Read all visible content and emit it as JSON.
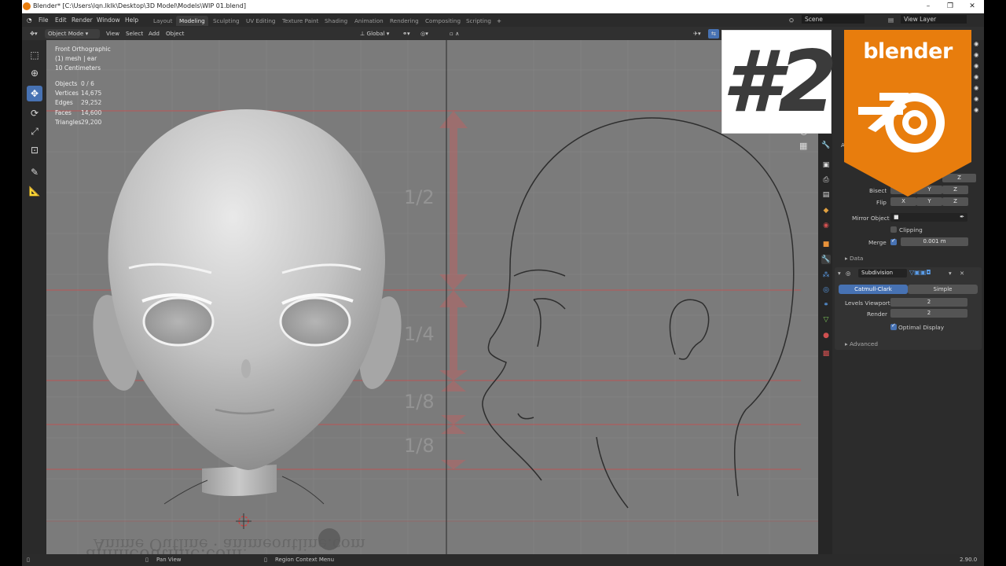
{
  "window": {
    "title": "Blender* [C:\\Users\\lqn.lklk\\Desktop\\3D Model\\Models\\WIP 01.blend]",
    "minimize": "–",
    "maximize": "❐",
    "close": "✕"
  },
  "menu": [
    "File",
    "Edit",
    "Render",
    "Window",
    "Help"
  ],
  "workspaces": [
    "Layout",
    "Modeling",
    "Sculpting",
    "UV Editing",
    "Texture Paint",
    "Shading",
    "Animation",
    "Rendering",
    "Compositing",
    "Scripting"
  ],
  "active_workspace": "Modeling",
  "add_workspace": "+",
  "scene": {
    "label": "Scene",
    "layer": "View Layer"
  },
  "header": {
    "mode": "Object Mode",
    "items": [
      "View",
      "Select",
      "Add",
      "Object"
    ],
    "orientation": "Global"
  },
  "viewport": {
    "view_name": "Front Orthographic",
    "object_info": "(1) mesh | ear",
    "scale": "10 Centimeters",
    "stats": [
      {
        "label": "Objects",
        "value": "0 / 6"
      },
      {
        "label": "Vertices",
        "value": "14,675"
      },
      {
        "label": "Edges",
        "value": "29,252"
      },
      {
        "label": "Faces",
        "value": "14,600"
      },
      {
        "label": "Triangles",
        "value": "29,200"
      }
    ],
    "proportion_labels": [
      "1/2",
      "1/4",
      "1/8",
      "1/8"
    ],
    "watermark": "Anime Outline · animeoutline.com"
  },
  "overlay": {
    "episode": "#2",
    "brand": "blender"
  },
  "properties": {
    "mirror": {
      "axis_z": "Z",
      "bisect_label": "Bisect",
      "flip_label": "Flip",
      "axes": [
        "X",
        "Y",
        "Z"
      ],
      "mirror_object_label": "Mirror Object",
      "clipping_label": "Clipping",
      "merge_label": "Merge",
      "merge_value": "0.001 m",
      "data_label": "Data"
    },
    "subdivision": {
      "name": "Subdivision",
      "catmull": "Catmull-Clark",
      "simple": "Simple",
      "levels_viewport_label": "Levels Viewport",
      "levels_viewport": "2",
      "render_label": "Render",
      "render": "2",
      "optimal_display": "Optimal Display",
      "advanced": "Advanced"
    }
  },
  "status": {
    "pan": "Pan View",
    "context": "Region Context Menu",
    "version": "2.90.0"
  },
  "colors": {
    "accent": "#4772b3",
    "blender_orange": "#e87d0d",
    "viewport_bg": "#7b7b7b"
  }
}
